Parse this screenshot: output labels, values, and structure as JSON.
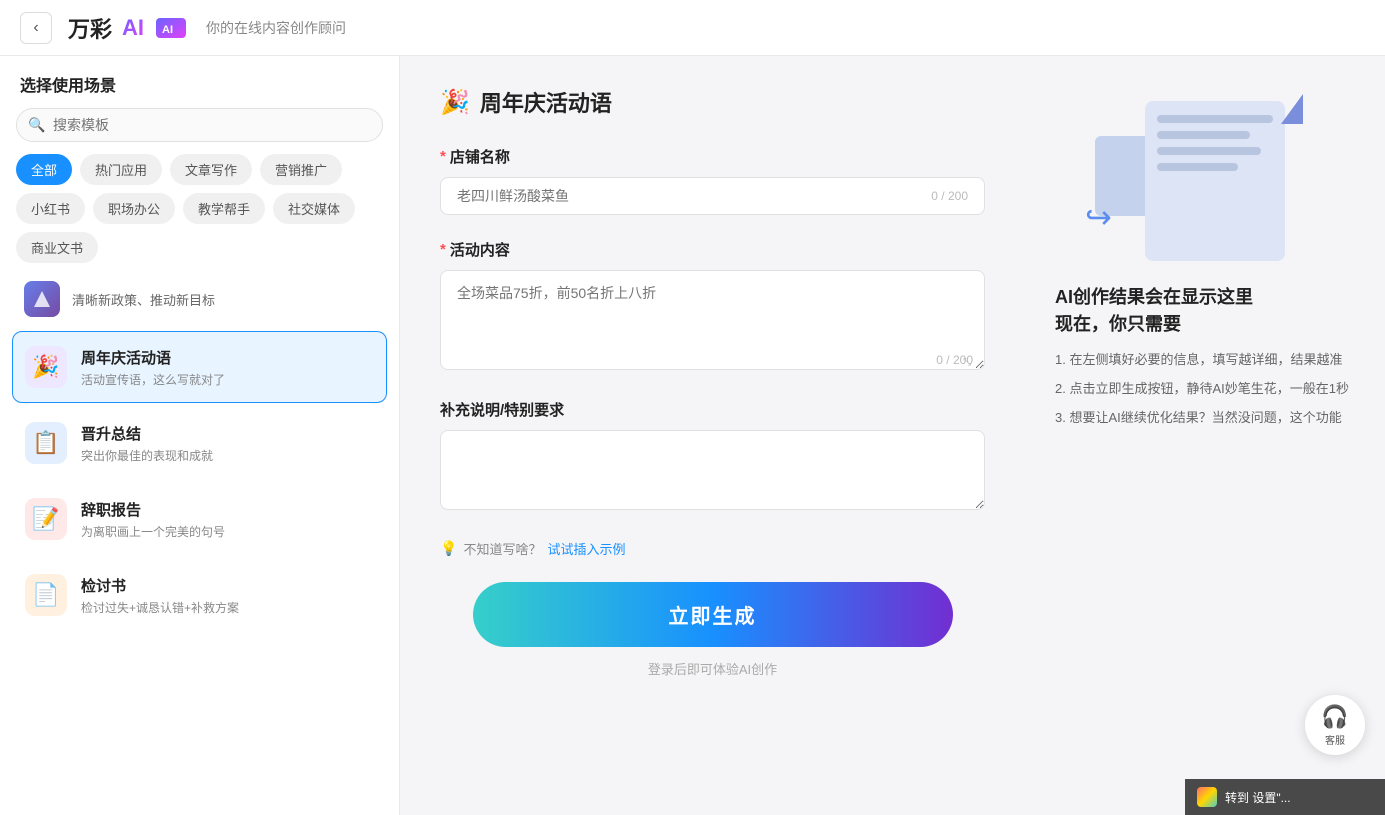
{
  "header": {
    "back_label": "‹",
    "logo_text": "万彩",
    "logo_ai": "AI",
    "subtitle": "你的在线内容创作顾问"
  },
  "sidebar": {
    "title": "选择使用场景",
    "search_placeholder": "搜索模板",
    "tags": [
      {
        "label": "全部",
        "active": true
      },
      {
        "label": "热门应用",
        "active": false
      },
      {
        "label": "文章写作",
        "active": false
      },
      {
        "label": "营销推广",
        "active": false
      },
      {
        "label": "小红书",
        "active": false
      },
      {
        "label": "职场办公",
        "active": false
      },
      {
        "label": "教学帮手",
        "active": false
      },
      {
        "label": "社交媒体",
        "active": false
      },
      {
        "label": "商业文书",
        "active": false
      }
    ],
    "special_item": {
      "text": "清晰新政策、推动新目标"
    },
    "list_items": [
      {
        "icon": "🎉",
        "icon_bg": "purple-bg",
        "title": "周年庆活动语",
        "desc": "活动宣传语，这么写就对了",
        "active": true
      },
      {
        "icon": "📋",
        "icon_bg": "blue-bg",
        "title": "晋升总结",
        "desc": "突出你最佳的表现和成就",
        "active": false
      },
      {
        "icon": "📝",
        "icon_bg": "red-bg",
        "title": "辞职报告",
        "desc": "为离职画上一个完美的句号",
        "active": false
      },
      {
        "icon": "📄",
        "icon_bg": "orange-bg",
        "title": "检讨书",
        "desc": "检讨过失+诚恳认错+补救方案",
        "active": false
      }
    ]
  },
  "form": {
    "title": "周年庆活动语",
    "title_icon": "🎉",
    "fields": [
      {
        "id": "shop_name",
        "label": "店铺名称",
        "required": true,
        "placeholder": "老四川鲜汤酸菜鱼",
        "value": "",
        "max": 200,
        "current": 0,
        "type": "input"
      },
      {
        "id": "activity_content",
        "label": "活动内容",
        "required": true,
        "placeholder": "全场菜品75折，前50名折上八折",
        "value": "",
        "max": 200,
        "current": 0,
        "type": "textarea"
      },
      {
        "id": "extra",
        "label": "补充说明/特别要求",
        "required": false,
        "placeholder": "",
        "value": "",
        "max": null,
        "current": null,
        "type": "textarea"
      }
    ],
    "hint": {
      "icon": "💡",
      "text": "不知道写啥？试试插入示例"
    },
    "generate_btn": "立即生成",
    "login_hint": "登录后即可体验AI创作"
  },
  "right_panel": {
    "title_line1": "AI创作结果会在显示这里",
    "title_line2": "现在，你只需要",
    "instructions": [
      "1. 在左侧填好必要的信息，填写越详细，结果越准",
      "2. 点击立即生成按钮，静待AI妙笔生花，一般在1秒",
      "3. 想要让AI继续优化结果？当然没问题，这个功能"
    ]
  },
  "customer_service": {
    "label": "客服"
  },
  "bottom_bar": {
    "text": "转到 设置\"..."
  }
}
